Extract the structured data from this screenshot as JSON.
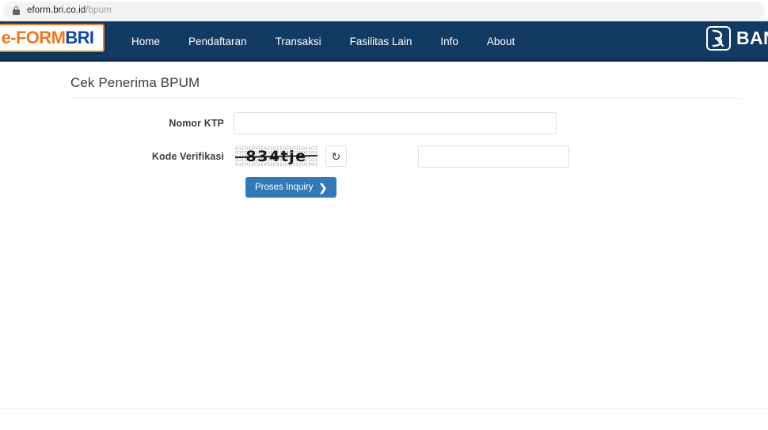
{
  "browser": {
    "lock_icon": "lock-icon",
    "url_host": "eform.bri.co.id",
    "url_path": "/bpum"
  },
  "navbar": {
    "logo": {
      "part1": "e-FORM",
      "part2": "BRI",
      "part1_color": "#ec7823",
      "part2_color": "#14479b",
      "border_color": "#e8822a"
    },
    "background_color": "#133a63",
    "links": [
      {
        "label": "Home"
      },
      {
        "label": "Pendaftaran"
      },
      {
        "label": "Transaksi"
      },
      {
        "label": "Fasilitas Lain"
      },
      {
        "label": "Info"
      },
      {
        "label": "About"
      }
    ],
    "bank_logo": {
      "mark_icon": "bri-logo-icon",
      "word": "BANK"
    }
  },
  "main": {
    "page_title": "Cek Penerima BPUM",
    "fields": {
      "ktp": {
        "label": "Nomor KTP",
        "value": "",
        "placeholder": ""
      },
      "captcha": {
        "label": "Kode Verifikasi",
        "image_text": "834tje",
        "refresh_icon": "refresh-icon",
        "refresh_glyph": "↻",
        "value": "",
        "placeholder": ""
      }
    },
    "submit": {
      "label": "Proses Inquiry",
      "chevron": "❯",
      "color": "#3279b7"
    }
  }
}
